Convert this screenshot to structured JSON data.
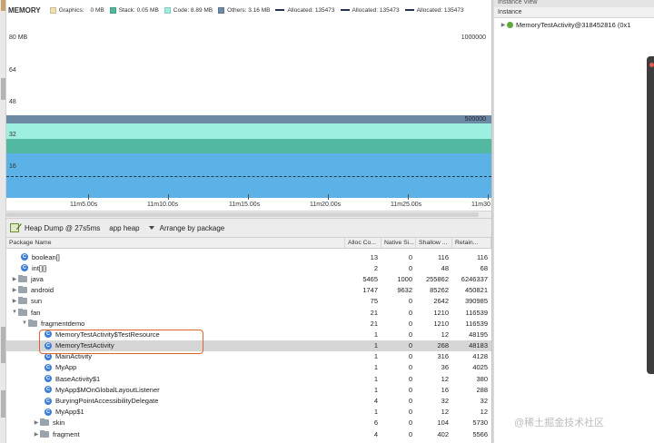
{
  "memory": {
    "title": "MEMORY",
    "legend": [
      {
        "label": "Graphics:",
        "value": "0 MB",
        "color": "#efe0b0",
        "kind": "swatch"
      },
      {
        "label": "Stack: 0.05 MB",
        "value": "",
        "color": "#53b8a0",
        "kind": "swatch"
      },
      {
        "label": "Code: 8.89 MB",
        "value": "",
        "color": "#9df0e0",
        "kind": "swatch"
      },
      {
        "label": "Others: 3.16 MB",
        "value": "",
        "color": "#6d8aa4",
        "kind": "swatch"
      },
      {
        "label": "Allocated: 135473",
        "value": "",
        "color": "#1d3a4a",
        "kind": "dash"
      },
      {
        "label": "Allocated: 135473",
        "value": "",
        "color": "#1d3a4a",
        "kind": "dash"
      },
      {
        "label": "Allocated: 135473",
        "value": "",
        "color": "#1d3a4a",
        "kind": "dash"
      }
    ],
    "y_axis_left": [
      "80 MB",
      "64",
      "48",
      "32",
      "16"
    ],
    "y_axis_right": [
      "1000000",
      "500000"
    ],
    "x_ticks": [
      "11m5.00s",
      "11m10.00s",
      "11m15.00s",
      "11m20.00s",
      "11m25.00s",
      "11m30"
    ]
  },
  "toolbar": {
    "dump_label": "Heap Dump @ 27s5ms",
    "heap_label": "app heap",
    "arrange_label": "Arrange by package"
  },
  "table": {
    "headers": [
      "Package Name",
      "Alloc Co...",
      "Native Si...",
      "Shallow ...",
      "Retain..."
    ],
    "rows": [
      {
        "name": "boolean[]",
        "alloc": "13",
        "native": "0",
        "shallow": "116",
        "retain": "116"
      },
      {
        "name": "int[][]",
        "alloc": "2",
        "native": "0",
        "shallow": "48",
        "retain": "68"
      },
      {
        "name": "java",
        "alloc": "5465",
        "native": "1000",
        "shallow": "255862",
        "retain": "6246337"
      },
      {
        "name": "android",
        "alloc": "1747",
        "native": "9632",
        "shallow": "85262",
        "retain": "450821"
      },
      {
        "name": "sun",
        "alloc": "75",
        "native": "0",
        "shallow": "2642",
        "retain": "390985"
      },
      {
        "name": "fan",
        "alloc": "21",
        "native": "0",
        "shallow": "1210",
        "retain": "116539"
      },
      {
        "name": "fragmentdemo",
        "alloc": "21",
        "native": "0",
        "shallow": "1210",
        "retain": "116539"
      },
      {
        "name": "MemoryTestActivity$TestResource",
        "alloc": "1",
        "native": "0",
        "shallow": "12",
        "retain": "48195"
      },
      {
        "name": "MemoryTestActivity",
        "alloc": "1",
        "native": "0",
        "shallow": "268",
        "retain": "48183"
      },
      {
        "name": "MainActivity",
        "alloc": "1",
        "native": "0",
        "shallow": "316",
        "retain": "4128"
      },
      {
        "name": "MyApp",
        "alloc": "1",
        "native": "0",
        "shallow": "36",
        "retain": "4025"
      },
      {
        "name": "BaseActivity$1",
        "alloc": "1",
        "native": "0",
        "shallow": "12",
        "retain": "380"
      },
      {
        "name": "MyApp$MOnGlobalLayoutListener",
        "alloc": "1",
        "native": "0",
        "shallow": "16",
        "retain": "288"
      },
      {
        "name": "BuryingPointAccessibilityDelegate",
        "alloc": "4",
        "native": "0",
        "shallow": "32",
        "retain": "32"
      },
      {
        "name": "MyApp$1",
        "alloc": "1",
        "native": "0",
        "shallow": "12",
        "retain": "12"
      },
      {
        "name": "skin",
        "alloc": "6",
        "native": "0",
        "shallow": "104",
        "retain": "5730"
      },
      {
        "name": "fragment",
        "alloc": "4",
        "native": "0",
        "shallow": "402",
        "retain": "5566"
      }
    ]
  },
  "instance_view": {
    "title": "Instance View",
    "column": "Instance",
    "item": "MemoryTestActivity@318452816 (0x1"
  },
  "watermark": "@稀土掘金技术社区"
}
